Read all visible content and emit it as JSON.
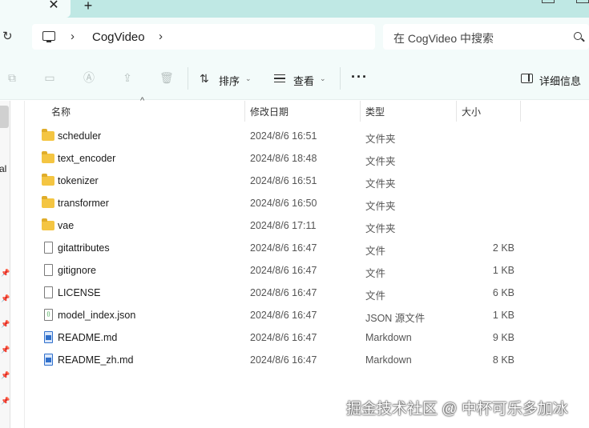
{
  "tabs": {
    "close_glyph": "✕",
    "new_glyph": "+"
  },
  "address": {
    "breadcrumb": "CogVideo",
    "search_placeholder": "在 CogVideo 中搜索"
  },
  "toolbar": {
    "sort_label": "排序",
    "view_label": "查看",
    "details_label": "详细信息",
    "more_glyph": "···"
  },
  "nav": {
    "partial_label": "al"
  },
  "columns": {
    "name": "名称",
    "modified": "修改日期",
    "type": "类型",
    "size": "大小"
  },
  "files": [
    {
      "name": "scheduler",
      "modified": "2024/8/6 16:51",
      "type": "文件夹",
      "size": "",
      "icon": "folder-icon"
    },
    {
      "name": "text_encoder",
      "modified": "2024/8/6 18:48",
      "type": "文件夹",
      "size": "",
      "icon": "folder-icon"
    },
    {
      "name": "tokenizer",
      "modified": "2024/8/6 16:51",
      "type": "文件夹",
      "size": "",
      "icon": "folder-icon"
    },
    {
      "name": "transformer",
      "modified": "2024/8/6 16:50",
      "type": "文件夹",
      "size": "",
      "icon": "folder-icon"
    },
    {
      "name": "vae",
      "modified": "2024/8/6 17:11",
      "type": "文件夹",
      "size": "",
      "icon": "folder-icon"
    },
    {
      "name": "gitattributes",
      "modified": "2024/8/6 16:47",
      "type": "文件",
      "size": "2 KB",
      "icon": "file-icon"
    },
    {
      "name": "gitignore",
      "modified": "2024/8/6 16:47",
      "type": "文件",
      "size": "1 KB",
      "icon": "file-icon"
    },
    {
      "name": "LICENSE",
      "modified": "2024/8/6 16:47",
      "type": "文件",
      "size": "6 KB",
      "icon": "file-icon"
    },
    {
      "name": "model_index.json",
      "modified": "2024/8/6 16:47",
      "type": "JSON 源文件",
      "size": "1 KB",
      "icon": "json-file-icon"
    },
    {
      "name": "README.md",
      "modified": "2024/8/6 16:47",
      "type": "Markdown",
      "size": "9 KB",
      "icon": "markdown-file-icon"
    },
    {
      "name": "README_zh.md",
      "modified": "2024/8/6 16:47",
      "type": "Markdown",
      "size": "8 KB",
      "icon": "markdown-file-icon"
    }
  ],
  "watermark": "掘金技术社区 @ 中杯可乐多加冰",
  "colors": {
    "chrome_bg": "#f3fbfa",
    "tabstrip_bg": "#bfe8e4",
    "folder": "#f4c542"
  }
}
